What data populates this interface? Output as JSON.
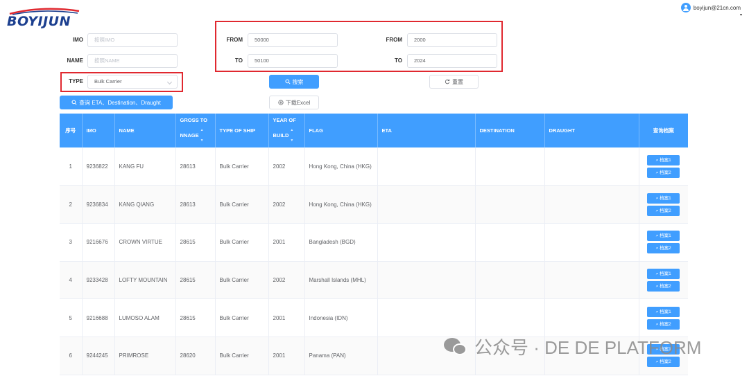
{
  "brand": {
    "logo_text": "BOYIJUN"
  },
  "user": {
    "email": "boyijun@21cn.com",
    "icon": "user-avatar-icon",
    "caret": "▾"
  },
  "filters": {
    "imo_label": "IMO",
    "imo_placeholder": "按照IMO",
    "name_label": "NAME",
    "name_placeholder": "按照NAME",
    "type_label": "TYPE",
    "type_value": "Bulk Carrier",
    "gt_from_label": "FROM",
    "gt_from_value": "50000",
    "gt_to_label": "TO",
    "gt_to_value": "50100",
    "year_from_label": "FROM",
    "year_from_value": "2000",
    "year_to_label": "TO",
    "year_to_value": "2024"
  },
  "actions": {
    "query_eta_label": "查询 ETA、Destination、Draught",
    "search_label": "搜索",
    "reset_label": "重置",
    "export_label": "下载Excel"
  },
  "table": {
    "headers": {
      "index": "序号",
      "imo": "IMO",
      "name": "NAME",
      "gross_a": "GROSS TO",
      "gross_b": "NNAGE",
      "type": "TYPE OF SHIP",
      "year_a": "YEAR OF",
      "year_b": "BUILD",
      "flag": "FLAG",
      "eta": "ETA",
      "destination": "DESTINATION",
      "draught": "DRAUGHT",
      "archive": "查询档案"
    },
    "archive_btn1": "档案1",
    "archive_btn2": "档案2",
    "rows": [
      {
        "index": "1",
        "imo": "9236822",
        "name": "KANG FU",
        "gross": "28613",
        "type": "Bulk Carrier",
        "year": "2002",
        "flag": "Hong Kong, China (HKG)",
        "eta": "",
        "destination": "",
        "draught": ""
      },
      {
        "index": "2",
        "imo": "9236834",
        "name": "KANG QIANG",
        "gross": "28613",
        "type": "Bulk Carrier",
        "year": "2002",
        "flag": "Hong Kong, China (HKG)",
        "eta": "",
        "destination": "",
        "draught": ""
      },
      {
        "index": "3",
        "imo": "9216676",
        "name": "CROWN VIRTUE",
        "gross": "28615",
        "type": "Bulk Carrier",
        "year": "2001",
        "flag": "Bangladesh (BGD)",
        "eta": "",
        "destination": "",
        "draught": ""
      },
      {
        "index": "4",
        "imo": "9233428",
        "name": "LOFTY MOUNTAIN",
        "gross": "28615",
        "type": "Bulk Carrier",
        "year": "2002",
        "flag": "Marshall Islands (MHL)",
        "eta": "",
        "destination": "",
        "draught": ""
      },
      {
        "index": "5",
        "imo": "9216688",
        "name": "LUMOSO ALAM",
        "gross": "28615",
        "type": "Bulk Carrier",
        "year": "2001",
        "flag": "Indonesia (IDN)",
        "eta": "",
        "destination": "",
        "draught": ""
      },
      {
        "index": "6",
        "imo": "9244245",
        "name": "PRIMROSE",
        "gross": "28620",
        "type": "Bulk Carrier",
        "year": "2001",
        "flag": "Panama (PAN)",
        "eta": "",
        "destination": "",
        "draught": ""
      }
    ]
  },
  "watermark": {
    "text": "公众号 · DE DE PLATFORM",
    "icon": "wechat-icon"
  },
  "colors": {
    "primary": "#409eff",
    "highlight": "#e0282f",
    "brand": "#1c3f8f"
  }
}
